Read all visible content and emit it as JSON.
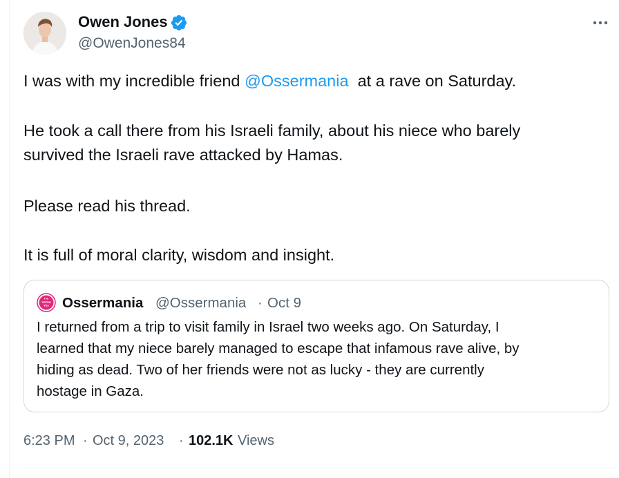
{
  "author": {
    "name": "Owen Jones",
    "handle": "@OwenJones84",
    "avatar_icon": "profile-photo",
    "verified_icon": "verified-badge-icon",
    "verified_color": "#1d9bf0"
  },
  "more_icon": "more-horizontal-icon",
  "tweet": {
    "line1_before": "I was with my incredible friend ",
    "mention": "@Ossermania",
    "line1_after": "  at a rave on Saturday.",
    "line2": "He took a call there from his Israeli family, about his niece who barely",
    "line3": "survived the Israeli rave attacked by Hamas.",
    "line4": "Please read his thread.",
    "line5": "It is full of moral clarity, wisdom and insight."
  },
  "quote": {
    "avatar_icon": "im-voting-yes-badge",
    "avatar_text": [
      "I'm",
      "Voting",
      "YES"
    ],
    "name": "Ossermania",
    "handle": "@Ossermania",
    "separator": "·",
    "date": "Oct 9",
    "lines": [
      "I returned from a trip to visit family in Israel two weeks ago. On Saturday, I",
      "learned that my niece barely managed to escape that infamous rave alive, by",
      "hiding as dead. Two of her friends were not as lucky - they are currently",
      "hostage in Gaza."
    ]
  },
  "meta": {
    "time": "6:23 PM",
    "separator": "·",
    "date": "Oct 9, 2023",
    "views_count": "102.1K",
    "views_label": "Views"
  },
  "colors": {
    "link": "#1d9bf0",
    "secondary_text": "#536471",
    "primary_text": "#0f1419",
    "border": "#cfd9de",
    "badge_pink": "#e0287a"
  }
}
